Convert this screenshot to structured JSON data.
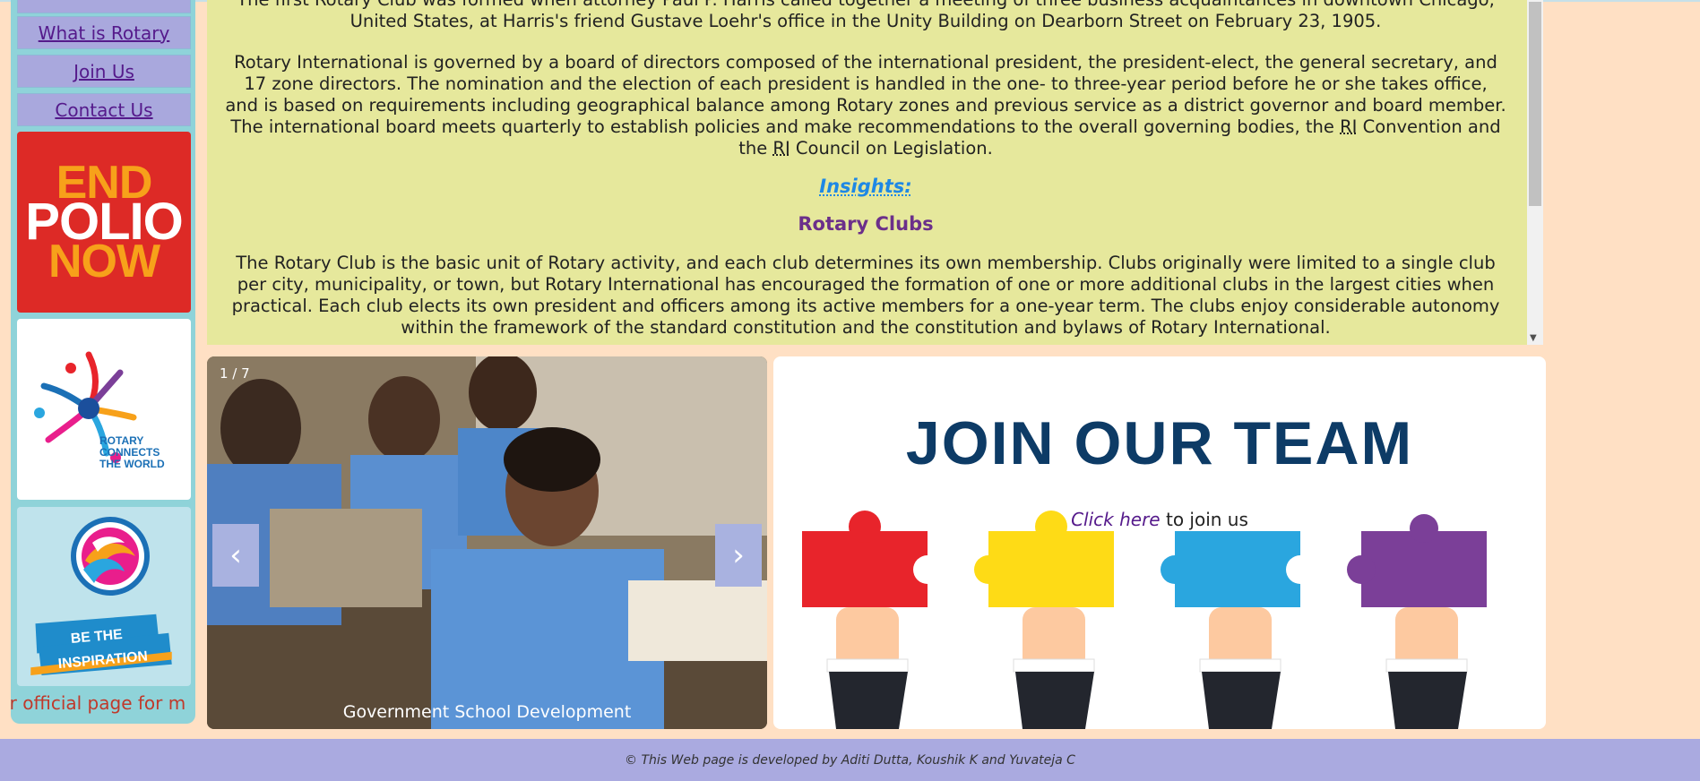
{
  "sidebar": {
    "nav": [
      {
        "label": "What is Rotary"
      },
      {
        "label": "Join Us"
      },
      {
        "label": "Contact Us"
      }
    ],
    "promos": {
      "polio": {
        "line1": "END",
        "line2": "POLIO",
        "line3": "NOW"
      },
      "connects": {
        "line1": "ROTARY",
        "line2": "CONNECTS",
        "line3": "THE WORLD"
      },
      "inspiration": {
        "line1": "BE THE",
        "line2": "INSPIRATION"
      }
    },
    "ticker": "ur official page for m"
  },
  "content": {
    "intro_line1": "The first Rotary Club was formed when attorney Paul P. Harris called together a meeting of three business acquaintances in downtown Chicago,",
    "intro_line2": "United States, at Harris's friend Gustave Loehr's office in the Unity Building on Dearborn Street on February 23, 1905.",
    "gov_line1": "Rotary International is governed by a board of directors composed of the international president, the president-elect, the general secretary, and",
    "gov_line2": "17 zone directors. The nomination and the election of each president is handled in the one- to three-year period before he or she takes office,",
    "gov_line3": "and is based on requirements including geographical balance among Rotary zones and previous service as a district governor and board member.",
    "gov_line4a": "The international board meets quarterly to establish policies and make recommendations to the overall governing bodies, the ",
    "gov_abbr1": "RI",
    "gov_line4b": " Convention and",
    "gov_line5a": "the ",
    "gov_abbr2": "RI",
    "gov_line5b": " Council on Legislation.",
    "insights": "Insights:",
    "clubs_heading": "Rotary Clubs",
    "clubs_line1": "The Rotary Club is the basic unit of Rotary activity, and each club determines its own membership. Clubs originally were limited to a single club",
    "clubs_line2": "per city, municipality, or town, but Rotary International has encouraged the formation of one or more additional clubs in the largest cities when",
    "clubs_line3": "practical. Each club elects its own president and officers among its active members for a one-year term. The clubs enjoy considerable autonomy",
    "clubs_line4": "within the framework of the standard constitution and the constitution and bylaws of Rotary International."
  },
  "slideshow": {
    "counter": "1 / 7",
    "prev": "‹",
    "next": "›",
    "caption": "Government School Development"
  },
  "join": {
    "title": "JOIN OUR TEAM",
    "cta_link": "Click here",
    "cta_rest": " to join us",
    "puzzle_colors": [
      "#e8242b",
      "#fedb16",
      "#2aa6df",
      "#7b3f98"
    ]
  },
  "footer": {
    "text": "© This Web page is developed by Aditi Dutta, Koushik K and Yuvateja C"
  }
}
